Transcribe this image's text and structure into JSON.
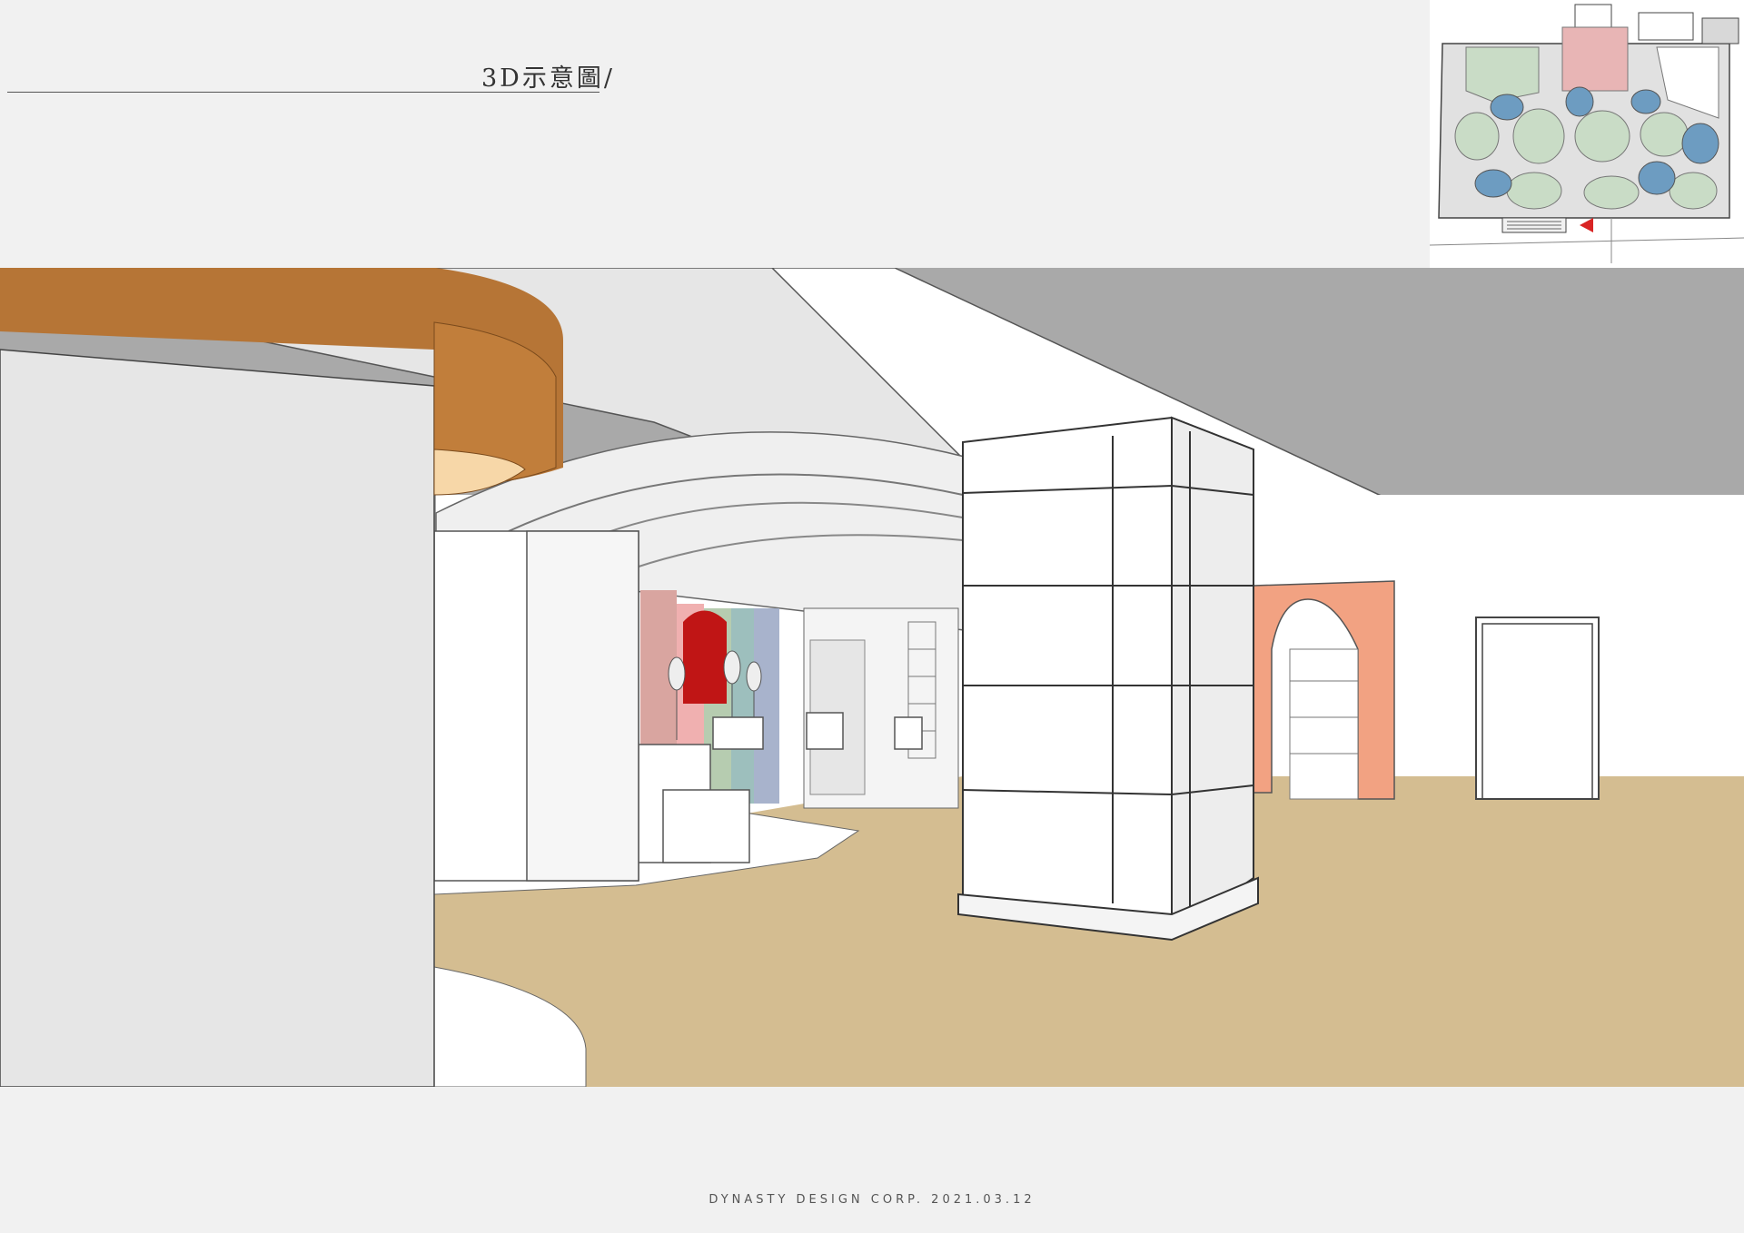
{
  "header": {
    "title": "3D示意圖/"
  },
  "key_plan": {
    "icon": "floor-plan-thumbnail"
  },
  "render": {
    "icon": "interior-3d-render"
  },
  "footer": {
    "credit": "DYNASTY DESIGN CORP. 2021.03.12"
  },
  "colors": {
    "background": "#f1f1f1",
    "floor": "#d4bd91",
    "ceiling": "#a9a9a9",
    "soffit_orange": "#b67536",
    "arch_salmon": "#f2a282",
    "plan_green": "#c9dcc6",
    "plan_blue": "#6d9cc1",
    "plan_pink": "#e8b5b5"
  }
}
